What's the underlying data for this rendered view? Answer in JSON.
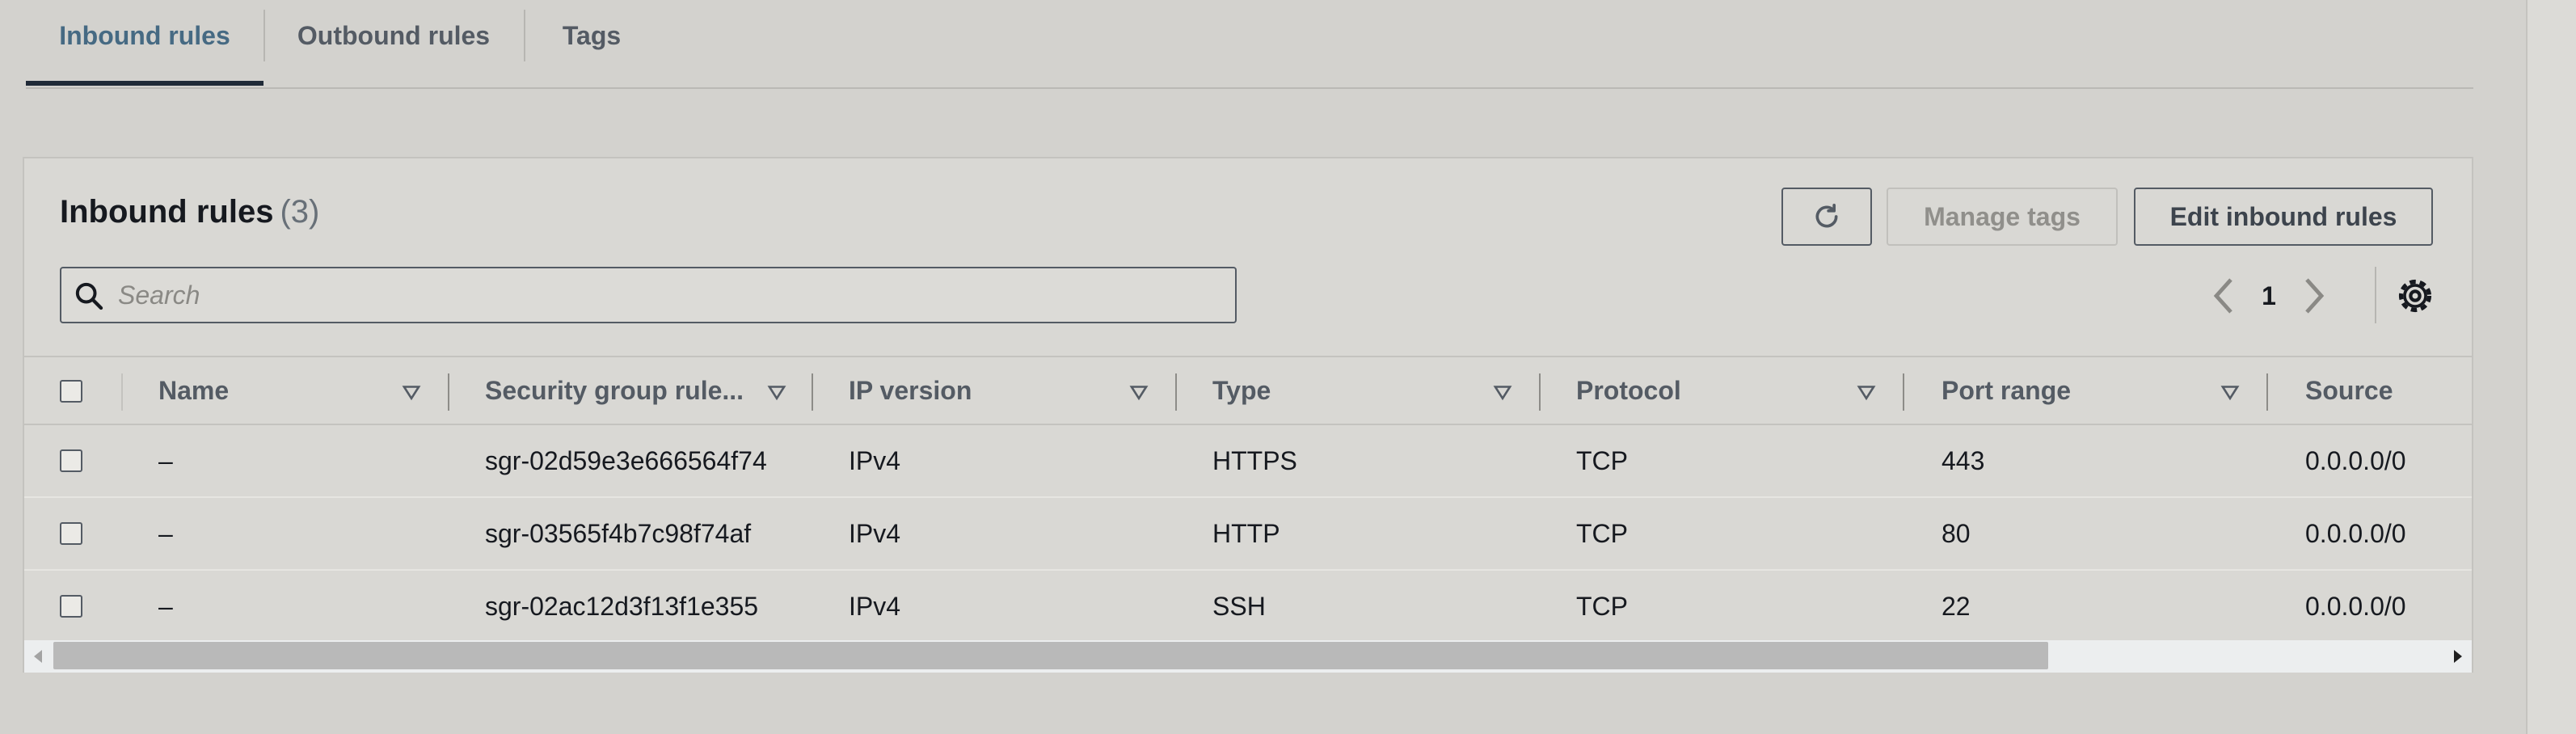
{
  "tabs": [
    {
      "label": "Inbound rules",
      "active": true
    },
    {
      "label": "Outbound rules",
      "active": false
    },
    {
      "label": "Tags",
      "active": false
    }
  ],
  "panel": {
    "title": "Inbound rules",
    "count": "(3)",
    "buttons": {
      "refresh_icon": "refresh-icon",
      "manage_tags": "Manage tags",
      "manage_tags_disabled": true,
      "edit_inbound_rules": "Edit inbound rules"
    },
    "search": {
      "placeholder": "Search",
      "value": ""
    },
    "pagination": {
      "current_page": "1"
    }
  },
  "table": {
    "columns": [
      "Name",
      "Security group rule...",
      "IP version",
      "Type",
      "Protocol",
      "Port range",
      "Source"
    ],
    "rows": [
      {
        "name": "–",
        "rule_id": "sgr-02d59e3e666564f74",
        "ip_version": "IPv4",
        "type": "HTTPS",
        "protocol": "TCP",
        "port_range": "443",
        "source": "0.0.0.0/0"
      },
      {
        "name": "–",
        "rule_id": "sgr-03565f4b7c98f74af",
        "ip_version": "IPv4",
        "type": "HTTP",
        "protocol": "TCP",
        "port_range": "80",
        "source": "0.0.0.0/0"
      },
      {
        "name": "–",
        "rule_id": "sgr-02ac12d3f13f1e355",
        "ip_version": "IPv4",
        "type": "SSH",
        "protocol": "TCP",
        "port_range": "22",
        "source": "0.0.0.0/0"
      }
    ]
  },
  "colors": {
    "active_tab": "#466a83",
    "text_primary": "#16191f",
    "text_secondary": "#545b64",
    "background": "#d3d2ce",
    "panel_background": "#d9d8d4"
  }
}
